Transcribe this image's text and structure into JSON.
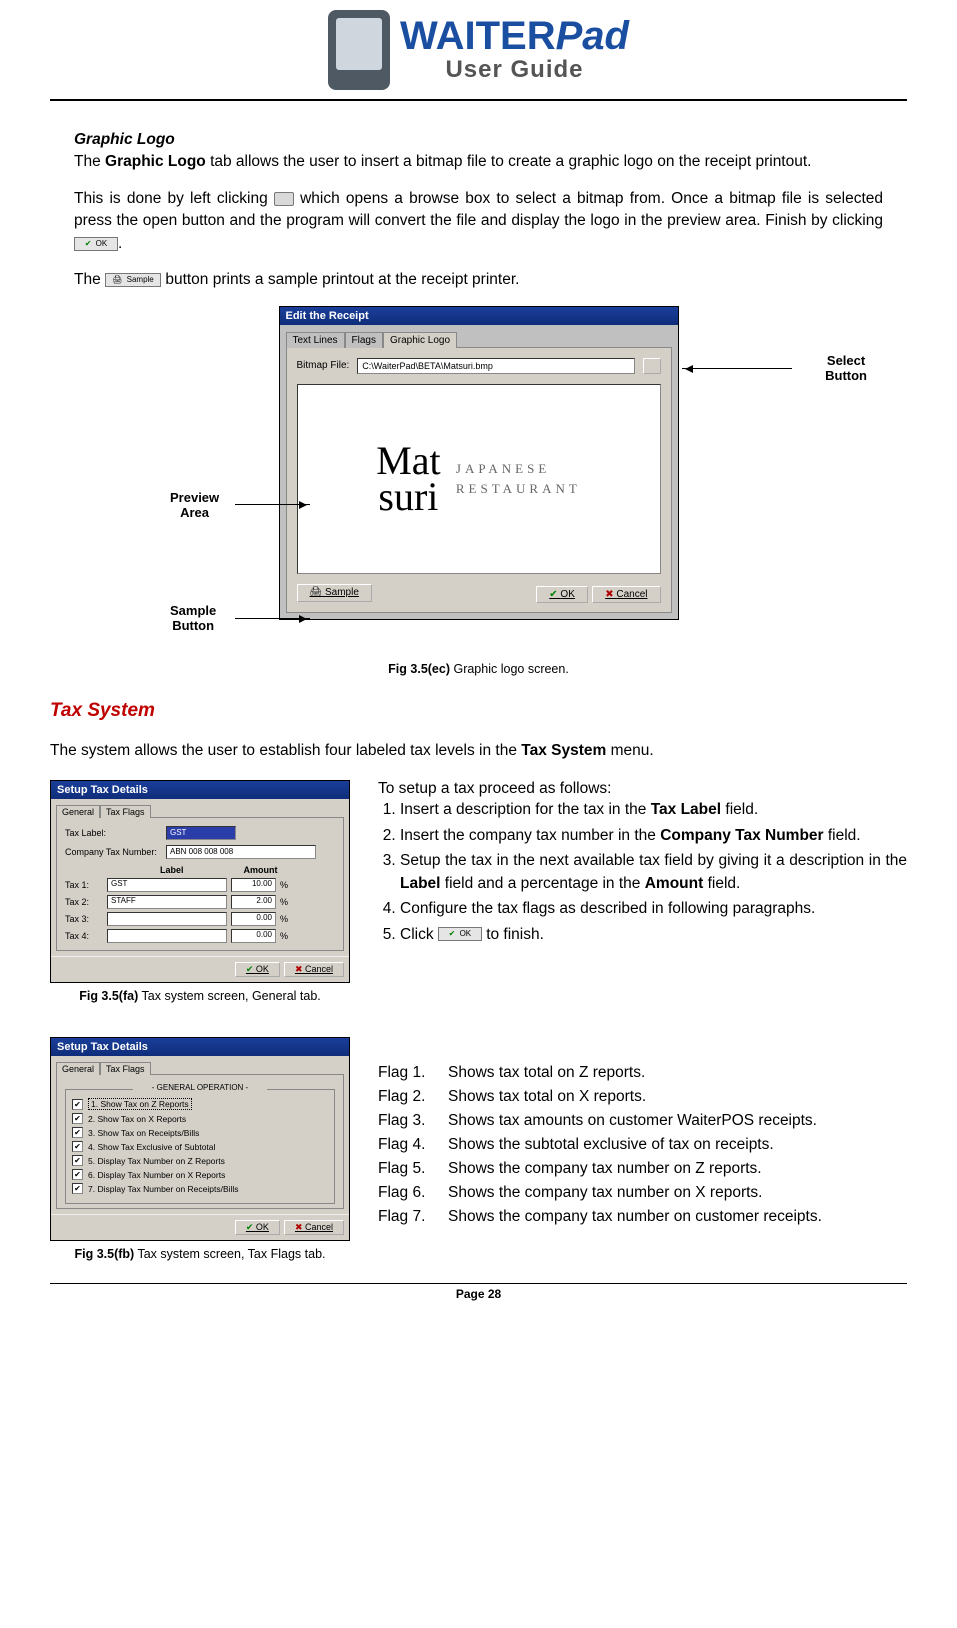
{
  "header": {
    "brand_main": "WAITER",
    "brand_suffix": "Pad",
    "subtitle": "User Guide"
  },
  "section_graphic_logo": {
    "heading": "Graphic Logo",
    "p1a": "The ",
    "p1b": "Graphic Logo",
    "p1c": " tab allows the user to insert a bitmap file to create a graphic logo on the receipt printout.",
    "p2a": "This is done by left clicking ",
    "p2b": " which opens a browse box to select a bitmap from. Once a bitmap file is selected press the open button and the program will convert the file and display the logo in the preview area. Finish by clicking ",
    "p2c": ".",
    "p3a": "The ",
    "p3b": " button prints a sample printout at the receipt printer."
  },
  "fig_ec": {
    "window_title": "Edit the Receipt",
    "tabs": {
      "t1": "Text Lines",
      "t2": "Flags",
      "t3": "Graphic Logo"
    },
    "field_label": "Bitmap File:",
    "field_value": "C:\\WaiterPad\\BETA\\Matsuri.bmp",
    "preview_big": "Mat\nsuri",
    "preview_line1": "JAPANESE",
    "preview_line2": "RESTAURANT",
    "btn_sample": "Sample",
    "btn_ok": "OK",
    "btn_cancel": "Cancel",
    "callouts": {
      "select": "Select\nButton",
      "preview": "Preview\nArea",
      "sample": "Sample\nButton"
    },
    "caption_bold": "Fig 3.5(ec)",
    "caption_rest": " Graphic logo screen."
  },
  "tax_system": {
    "heading": "Tax System",
    "intro_a": "The system allows the user to establish four labeled tax levels in the ",
    "intro_b": "Tax System",
    "intro_c": " menu.",
    "steps_intro": "To setup a tax proceed as follows:",
    "steps": [
      {
        "a": "Insert a description for the tax in the ",
        "b": "Tax Label",
        "c": " field."
      },
      {
        "a": "Insert the company tax number in the ",
        "b": "Company Tax Number",
        "c": " field."
      },
      {
        "a": "Setup the tax in the next available tax field by giving it a description in the ",
        "b": "Label",
        "c": " field and a percentage in the ",
        "d": "Amount",
        "e": " field."
      },
      {
        "a": "Configure the tax flags as described in following paragraphs.",
        "b": "",
        "c": ""
      },
      {
        "a": "Click ",
        "b": "",
        "c": " to finish."
      }
    ]
  },
  "fig_fa": {
    "window_title": "Setup Tax Details",
    "tabs": {
      "t1": "General",
      "t2": "Tax Flags"
    },
    "row1_label": "Tax Label:",
    "row1_value": "GST",
    "row2_label": "Company Tax Number:",
    "row2_value": "ABN 008 008 008",
    "col_label": "Label",
    "col_amount": "Amount",
    "rows": [
      {
        "name": "Tax 1:",
        "label": "GST",
        "amount": "10.00"
      },
      {
        "name": "Tax 2:",
        "label": "STAFF",
        "amount": "2.00"
      },
      {
        "name": "Tax 3:",
        "label": "",
        "amount": "0.00"
      },
      {
        "name": "Tax 4:",
        "label": "",
        "amount": "0.00"
      }
    ],
    "btn_ok": "OK",
    "btn_cancel": "Cancel",
    "caption_bold": "Fig 3.5(fa)",
    "caption_rest": " Tax system screen, General tab."
  },
  "fig_fb": {
    "window_title": "Setup Tax Details",
    "tabs": {
      "t1": "General",
      "t2": "Tax Flags"
    },
    "group_title": "- GENERAL OPERATION -",
    "checks": [
      "1. Show Tax on Z Reports",
      "2. Show Tax on X Reports",
      "3. Show Tax on Receipts/Bills",
      "4. Show Tax Exclusive of Subtotal",
      "5. Display Tax Number on Z Reports",
      "6. Display Tax Number on X Reports",
      "7. Display Tax Number on Receipts/Bills"
    ],
    "btn_ok": "OK",
    "btn_cancel": "Cancel",
    "caption_bold": "Fig 3.5(fb)",
    "caption_rest": " Tax system screen, Tax Flags tab."
  },
  "flags_text": [
    {
      "k": "Flag 1.",
      "v": "Shows tax total on Z reports."
    },
    {
      "k": "Flag 2.",
      "v": "Shows tax total on X reports."
    },
    {
      "k": "Flag 3.",
      "v": "Shows tax amounts on customer WaiterPOS receipts."
    },
    {
      "k": "Flag 4.",
      "v": "Shows the subtotal exclusive of tax on receipts."
    },
    {
      "k": "Flag 5.",
      "v": "Shows the company tax number on Z reports."
    },
    {
      "k": "Flag 6.",
      "v": "Shows the company tax number on X reports."
    },
    {
      "k": "Flag 7.",
      "v": "Shows the company tax number on customer receipts."
    }
  ],
  "footer": {
    "page": "Page 28"
  }
}
